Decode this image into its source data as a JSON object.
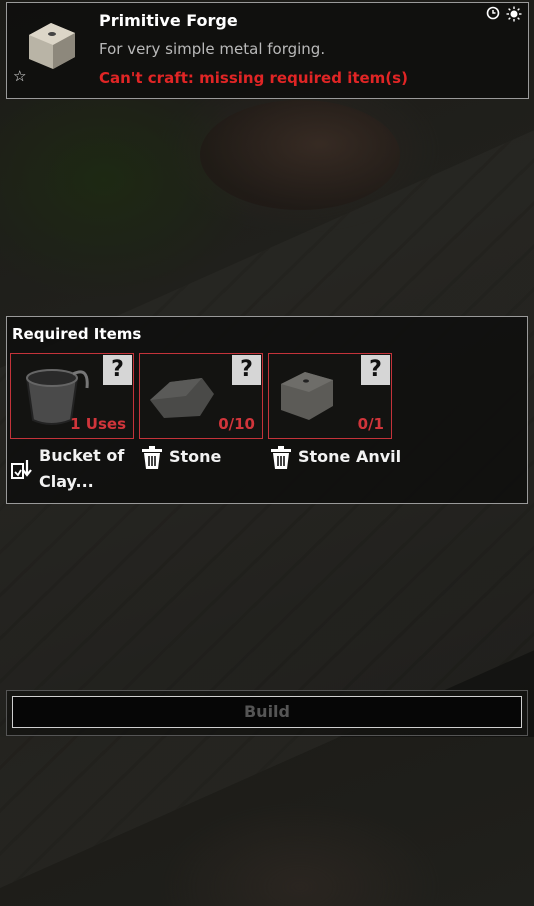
{
  "recipe": {
    "title": "Primitive Forge",
    "description": "For very simple metal forging.",
    "status": "Can't craft: missing required item(s)",
    "favorite_icon": "star-outline-icon",
    "header_icons": [
      "clock-icon",
      "sun-icon"
    ]
  },
  "required": {
    "title": "Required Items",
    "items": [
      {
        "icon": "bucket-icon",
        "quantity": "1 Uses",
        "label_line1": "Bucket of",
        "label_line2": "Clay...",
        "label_icon": "swap-icon",
        "unknown": "?"
      },
      {
        "icon": "stone-icon",
        "quantity": "0/10",
        "label_line1": "Stone",
        "label_icon": "trash-icon",
        "unknown": "?"
      },
      {
        "icon": "stone-anvil-icon",
        "quantity": "0/1",
        "label_line1": "Stone Anvil",
        "label_icon": "trash-icon",
        "unknown": "?"
      }
    ]
  },
  "build": {
    "label": "Build"
  },
  "colors": {
    "missing": "#e02525",
    "slot_border": "#c4333a"
  }
}
